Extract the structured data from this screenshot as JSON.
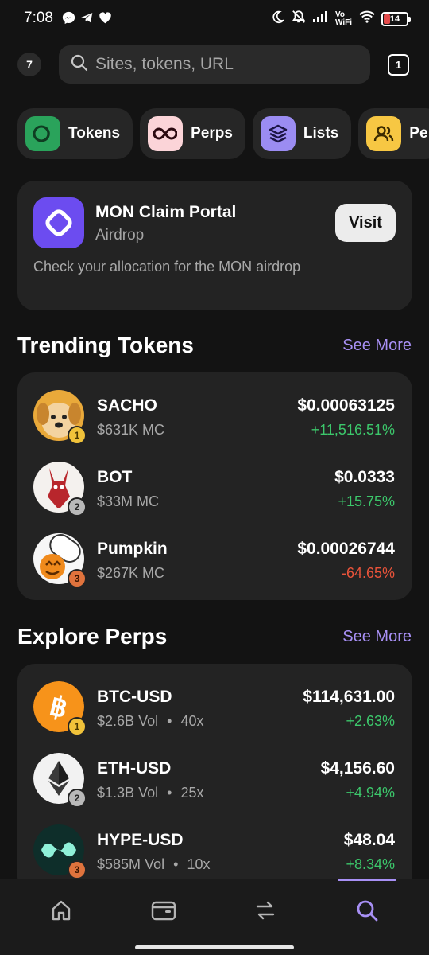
{
  "status_bar": {
    "time": "7:08",
    "network_label": "Vo WiFi",
    "battery": "14",
    "icons": [
      "messenger-icon",
      "telegram-icon",
      "heart-icon",
      "moon-icon",
      "mute-icon",
      "signal-icon",
      "wifi-icon",
      "battery-icon"
    ]
  },
  "header": {
    "account_count": "7",
    "search": {
      "placeholder": "Sites, tokens, URL",
      "value": ""
    },
    "tab_count": "1"
  },
  "chips": [
    {
      "label": "Tokens",
      "icon": "tokens-icon",
      "bg": "#2aa35b"
    },
    {
      "label": "Perps",
      "icon": "infinity-icon",
      "bg": "#fbd4d8"
    },
    {
      "label": "Lists",
      "icon": "layers-icon",
      "bg": "#9b8cf2"
    },
    {
      "label": "Pe",
      "icon": "people-icon",
      "bg": "#f7c743"
    }
  ],
  "promo": {
    "title": "MON Claim Portal",
    "subtitle": "Airdrop",
    "description": "Check your allocation for the MON airdrop",
    "button": "Visit"
  },
  "trending": {
    "title": "Trending Tokens",
    "see_more": "See More",
    "items": [
      {
        "rank": "1",
        "name": "SACHO",
        "sub": "$631K MC",
        "price": "$0.00063125",
        "change": "+11,516.51%",
        "direction": "up"
      },
      {
        "rank": "2",
        "name": "BOT",
        "sub": "$33M MC",
        "price": "$0.0333",
        "change": "+15.75%",
        "direction": "up"
      },
      {
        "rank": "3",
        "name": "Pumpkin",
        "sub": "$267K MC",
        "price": "$0.00026744",
        "change": "-64.65%",
        "direction": "down"
      }
    ]
  },
  "perps": {
    "title": "Explore Perps",
    "see_more": "See More",
    "items": [
      {
        "rank": "1",
        "name": "BTC-USD",
        "volume": "$2.6B",
        "vol_label": "Vol",
        "separator": "•",
        "leverage": "40x",
        "price": "$114,631.00",
        "change": "+2.63%",
        "direction": "up"
      },
      {
        "rank": "2",
        "name": "ETH-USD",
        "volume": "$1.3B",
        "vol_label": "Vol",
        "separator": "•",
        "leverage": "25x",
        "price": "$4,156.60",
        "change": "+4.94%",
        "direction": "up"
      },
      {
        "rank": "3",
        "name": "HYPE-USD",
        "volume": "$585M",
        "vol_label": "Vol",
        "separator": "•",
        "leverage": "10x",
        "price": "$48.04",
        "change": "+8.34%",
        "direction": "up"
      }
    ]
  },
  "bottom_nav": {
    "items": [
      "home-icon",
      "wallet-icon",
      "swap-icon",
      "search-icon"
    ],
    "active": "search-icon"
  },
  "colors": {
    "background": "#131313",
    "card": "#232323",
    "accent": "#a890f5",
    "positive": "#3cc76b",
    "negative": "#e8533a",
    "rank_gold": "#f0c23a",
    "rank_silver": "#b9b9b9",
    "rank_bronze": "#e0733d"
  }
}
